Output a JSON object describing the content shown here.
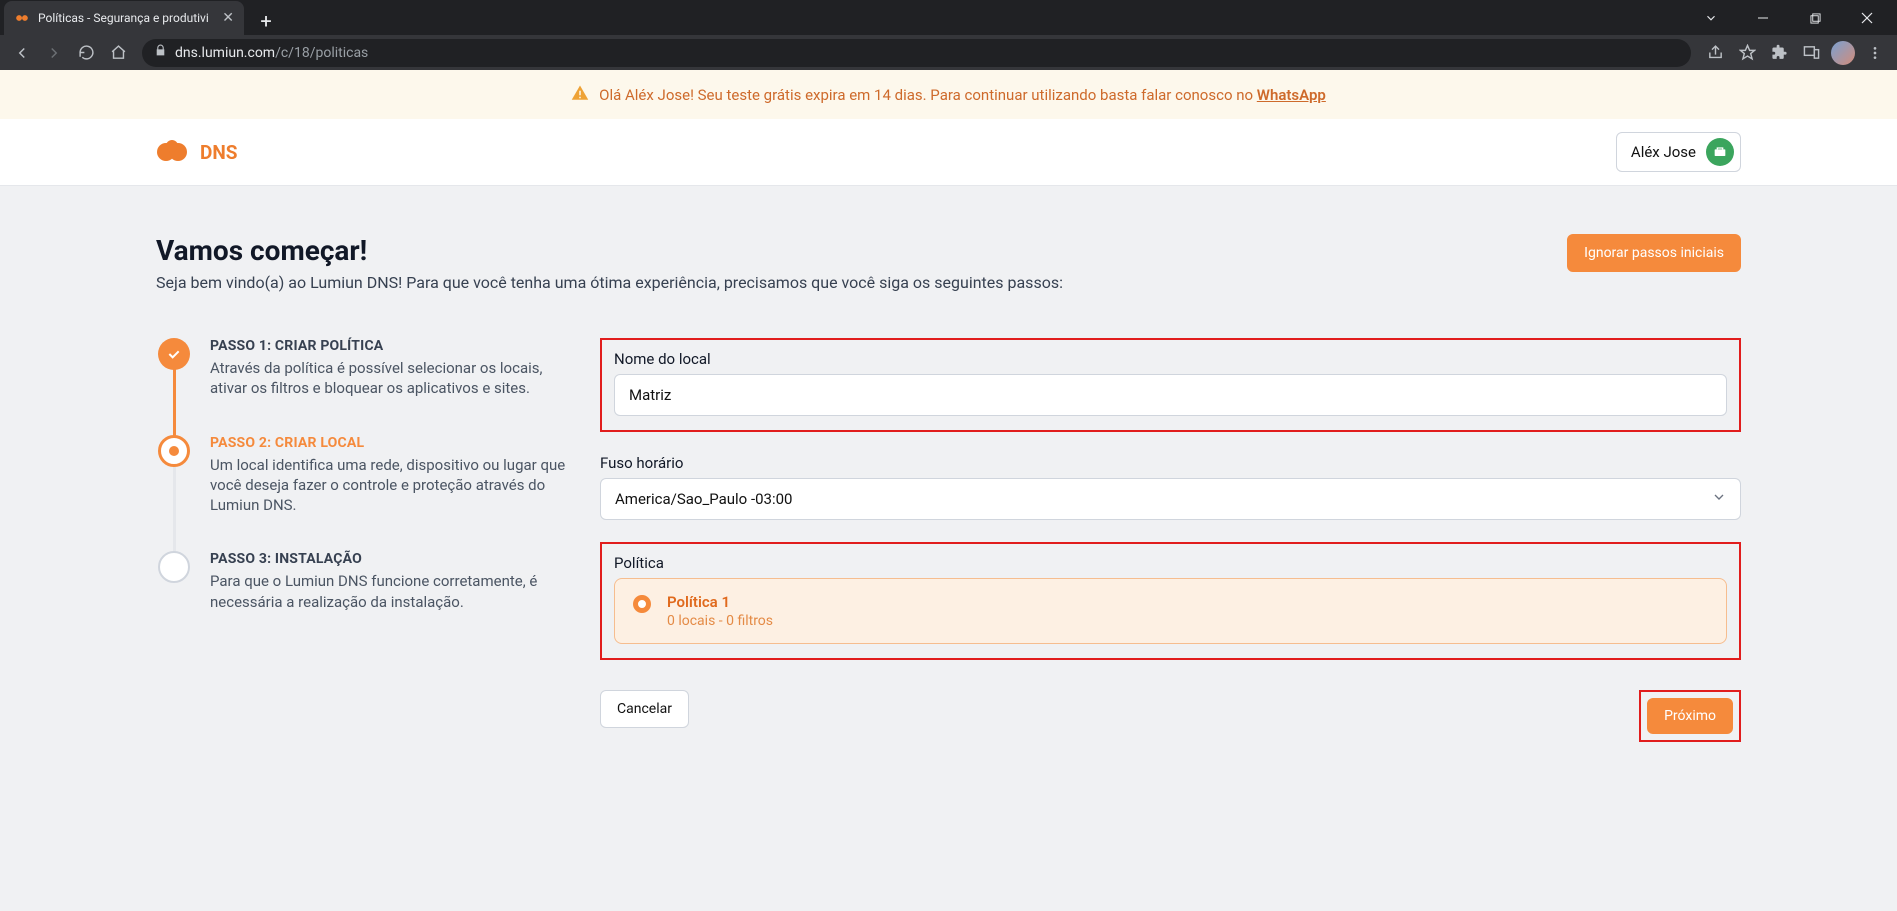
{
  "browser": {
    "tab_title": "Políticas - Segurança e produtivi",
    "url_host": "dns.lumiun.com",
    "url_path": "/c/18/politicas"
  },
  "banner": {
    "text_prefix": "Olá Aléx Jose! Seu teste grátis expira em 14 dias. Para continuar utilizando basta falar conosco no ",
    "link_text": "WhatsApp"
  },
  "header": {
    "product_name": "DNS",
    "user_name": "Aléx Jose"
  },
  "page": {
    "title": "Vamos começar!",
    "subtitle": "Seja bem vindo(a) ao Lumiun DNS! Para que você tenha uma ótima experiência, precisamos que você siga os seguintes passos:",
    "skip_label": "Ignorar passos iniciais"
  },
  "steps": [
    {
      "title": "PASSO 1: CRIAR POLÍTICA",
      "desc": "Através da política é possível selecionar os locais, ativar os filtros e bloquear os aplicativos e sites.",
      "state": "done"
    },
    {
      "title": "PASSO 2: CRIAR LOCAL",
      "desc": "Um local identifica uma rede, dispositivo ou lugar que você deseja fazer o controle e proteção através do Lumiun DNS.",
      "state": "current"
    },
    {
      "title": "PASSO 3: INSTALAÇÃO",
      "desc": "Para que o Lumiun DNS funcione corretamente, é necessária a realização da instalação.",
      "state": "future"
    }
  ],
  "form": {
    "local_name": {
      "label": "Nome do local",
      "value": "Matriz"
    },
    "timezone": {
      "label": "Fuso horário",
      "value": "America/Sao_Paulo -03:00"
    },
    "policy": {
      "label": "Política",
      "option_name": "Política 1",
      "option_sub": "0 locais - 0 filtros"
    },
    "cancel_label": "Cancelar",
    "next_label": "Próximo"
  }
}
